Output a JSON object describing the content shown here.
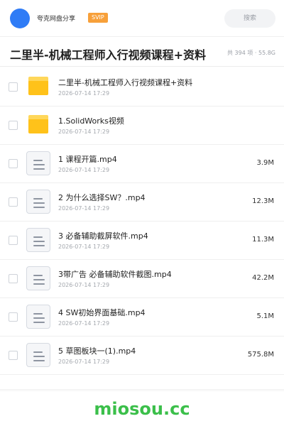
{
  "header": {
    "username": "夸克网盘分享",
    "badge": "SVIP",
    "search_placeholder": "搜索"
  },
  "folder": {
    "title": "二里半-机械工程师入行视频课程+资料",
    "summary": "共 394 项 · 55.8G"
  },
  "items": [
    {
      "type": "folder",
      "name": "二里半-机械工程师入行视频课程+资料",
      "date": "2026-07-14 17:29",
      "size": ""
    },
    {
      "type": "folder",
      "name": "1.SolidWorks视频",
      "date": "2026-07-14 17:29",
      "size": ""
    },
    {
      "type": "file",
      "name": "1 课程开篇.mp4",
      "date": "2026-07-14 17:29",
      "size": "3.9M"
    },
    {
      "type": "file",
      "name": "2 为什么选择SW？.mp4",
      "date": "2026-07-14 17:29",
      "size": "12.3M"
    },
    {
      "type": "file",
      "name": "3 必备辅助截屏软件.mp4",
      "date": "2026-07-14 17:29",
      "size": "11.3M"
    },
    {
      "type": "file",
      "name": "3带广告 必备辅助软件截图.mp4",
      "date": "2026-07-14 17:29",
      "size": "42.2M"
    },
    {
      "type": "file",
      "name": "4 SW初始界面基础.mp4",
      "date": "2026-07-14 17:29",
      "size": "5.1M"
    },
    {
      "type": "file",
      "name": "5 草图板块一(1).mp4",
      "date": "2026-07-14 17:29",
      "size": "575.8M"
    }
  ],
  "watermark": "miosou.cc"
}
